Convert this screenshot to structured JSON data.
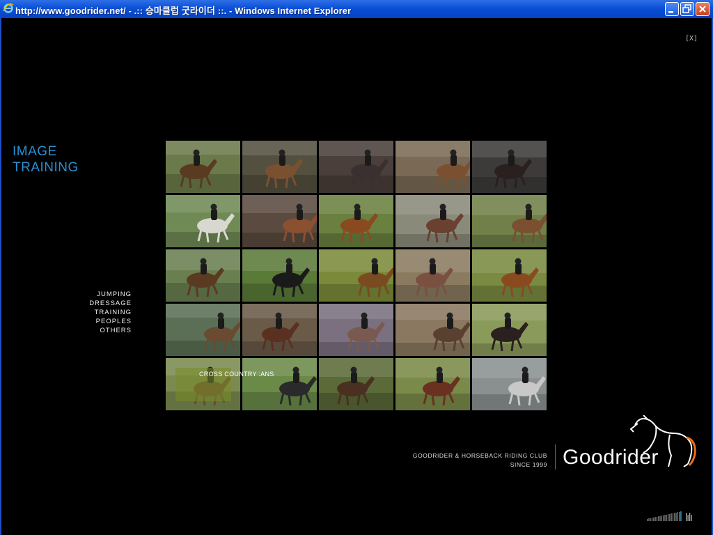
{
  "window": {
    "title": "http://www.goodrider.net/ - .:: 승마클럽 굿라이더 ::. - Windows Internet Explorer"
  },
  "close_label": "[X]",
  "section": {
    "title_line1": "IMAGE",
    "title_line2": "TRAINING"
  },
  "menu": {
    "items": [
      "JUMPING",
      "DRESSAGE",
      "TRAINING",
      "PEOPLES",
      "OTHERS"
    ]
  },
  "gallery": {
    "hover_label": "CROSS COUNTRY :ANS",
    "tile_colors": [
      [
        "#6b7a4a",
        "#54503f",
        "#4a3f3a",
        "#7a6a55",
        "#3d3a3a"
      ],
      [
        "#6f8a55",
        "#5a4a3f",
        "#6a8040",
        "#8a8a7a",
        "#708048"
      ],
      [
        "#6a7f50",
        "#5a7a38",
        "#7a8a3a",
        "#8a7a60",
        "#7a8a40"
      ],
      [
        "#5a6f55",
        "#6a5a48",
        "#7a7080",
        "#8a7860",
        "#8a9a5a"
      ],
      [
        "#7a8a50",
        "#6a8a48",
        "#5a6a38",
        "#7a8a48",
        "#8a9090"
      ]
    ],
    "horse_colors": [
      [
        "#5a3a20",
        "#7a5030",
        "#3a3030",
        "#7a5030",
        "#2a2020"
      ],
      [
        "#d8d8d0",
        "#8a5030",
        "#8a4a20",
        "#6a4030",
        "#7a5030"
      ],
      [
        "#5a3a20",
        "#1a1a1a",
        "#7a4a20",
        "#7a5040",
        "#8a4a20"
      ],
      [
        "#6a4a30",
        "#5a3020",
        "#7a5a50",
        "#5a4030",
        "#2a2020"
      ],
      [
        "#6a4a30",
        "#2a2a2a",
        "#4a3020",
        "#6a3020",
        "#c8c8c8"
      ]
    ]
  },
  "footer": {
    "club": "GOODRIDER & HORSEBACK RIDING CLUB",
    "since": "SINCE 1999",
    "brand": "Goodrider"
  }
}
